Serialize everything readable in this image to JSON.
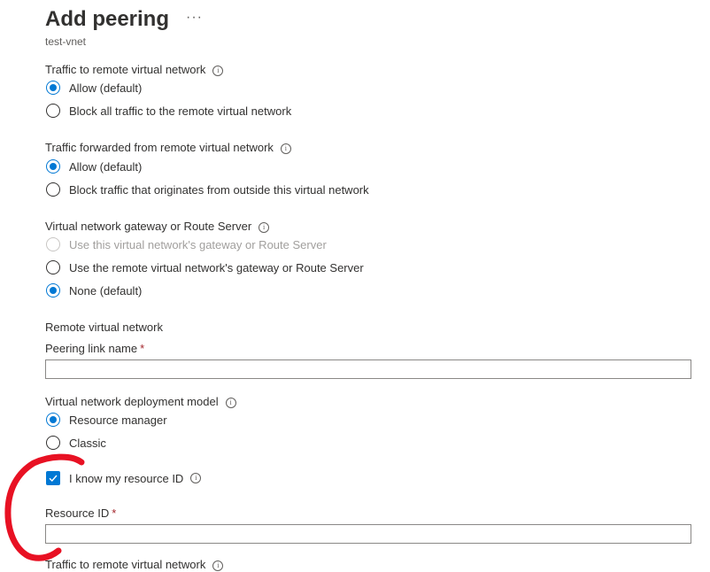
{
  "header": {
    "title": "Add peering",
    "more_label": "···",
    "subtitle": "test-vnet"
  },
  "traffic_to_remote": {
    "label": "Traffic to remote virtual network",
    "options": [
      {
        "label": "Allow (default)",
        "checked": true
      },
      {
        "label": "Block all traffic to the remote virtual network",
        "checked": false
      }
    ]
  },
  "traffic_forwarded": {
    "label": "Traffic forwarded from remote virtual network",
    "options": [
      {
        "label": "Allow (default)",
        "checked": true
      },
      {
        "label": "Block traffic that originates from outside this virtual network",
        "checked": false
      }
    ]
  },
  "gateway": {
    "label": "Virtual network gateway or Route Server",
    "options": [
      {
        "label": "Use this virtual network's gateway or Route Server",
        "checked": false,
        "disabled": true
      },
      {
        "label": "Use the remote virtual network's gateway or Route Server",
        "checked": false
      },
      {
        "label": "None (default)",
        "checked": true
      }
    ]
  },
  "remote_vnet": {
    "heading": "Remote virtual network",
    "peering_link_label": "Peering link name",
    "peering_link_value": "",
    "required_mark": "*",
    "deployment_model_label": "Virtual network deployment model",
    "deployment_options": [
      {
        "label": "Resource manager",
        "checked": true
      },
      {
        "label": "Classic",
        "checked": false
      }
    ],
    "know_resource_id_label": "I know my resource ID",
    "know_resource_id_checked": true,
    "resource_id_label": "Resource ID",
    "resource_id_value": "",
    "clipped_label": "Traffic to remote virtual network"
  },
  "colors": {
    "accent": "#0078d4",
    "annotation": "#e81123",
    "required": "#a4262c"
  }
}
